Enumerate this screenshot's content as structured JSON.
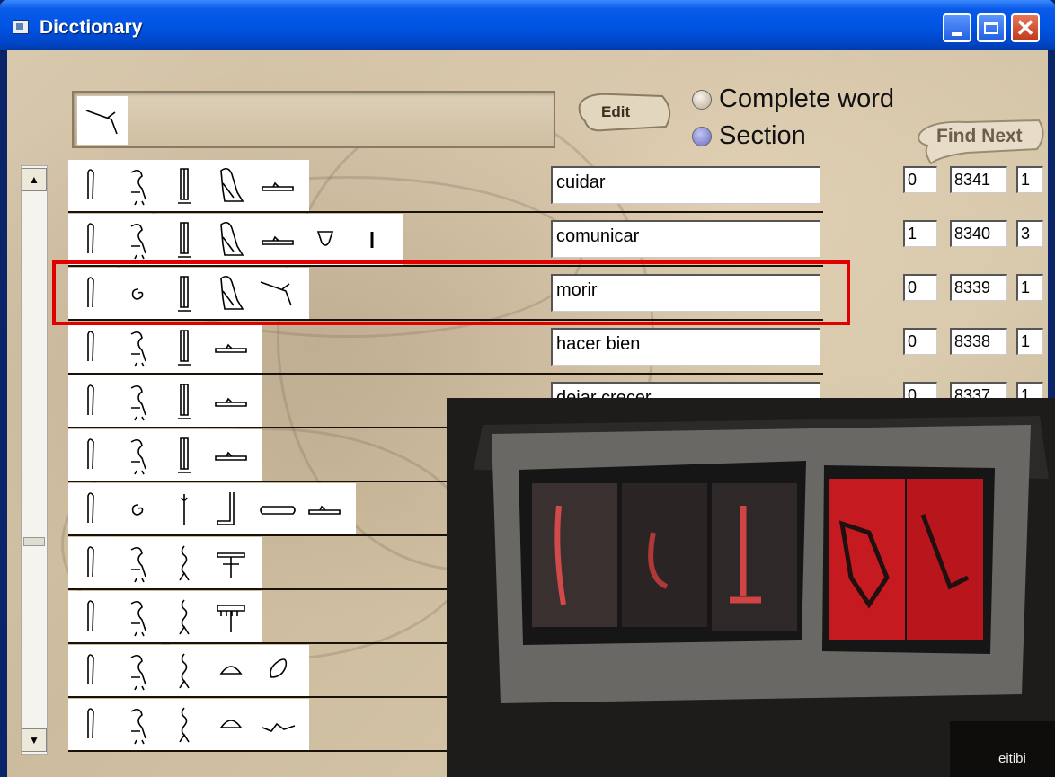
{
  "window": {
    "title": "Dicctionary"
  },
  "search": {
    "glyphs": [
      "stick"
    ]
  },
  "edit_label": "Edit",
  "radios": [
    {
      "label": "Complete word",
      "selected": false
    },
    {
      "label": "Section",
      "selected": true
    }
  ],
  "find_next_label": "Find Next",
  "rows": [
    {
      "glyphs": [
        "reed",
        "vulture",
        "column",
        "bird",
        "water"
      ],
      "word": "cuidar",
      "n1": "0",
      "n2": "8341",
      "n3": "1"
    },
    {
      "glyphs": [
        "reed",
        "vulture",
        "column",
        "bird",
        "water",
        "pot",
        "stroke"
      ],
      "word": "comunicar",
      "n1": "1",
      "n2": "8340",
      "n3": "3"
    },
    {
      "glyphs": [
        "reed",
        "spiral",
        "column",
        "bird",
        "stick"
      ],
      "word": "morir",
      "n1": "0",
      "n2": "8339",
      "n3": "1"
    },
    {
      "glyphs": [
        "reed",
        "vulture",
        "column",
        "water"
      ],
      "word": "hacer bien",
      "n1": "0",
      "n2": "8338",
      "n3": "1"
    },
    {
      "glyphs": [
        "reed",
        "vulture",
        "column",
        "water"
      ],
      "word": "dejar crecer",
      "n1": "0",
      "n2": "8337",
      "n3": "1"
    },
    {
      "glyphs": [
        "reed",
        "vulture",
        "column",
        "water"
      ]
    },
    {
      "glyphs": [
        "reed",
        "spiral",
        "plant",
        "boot",
        "bar",
        "water"
      ]
    },
    {
      "glyphs": [
        "reed",
        "vulture",
        "rope",
        "table"
      ]
    },
    {
      "glyphs": [
        "reed",
        "vulture",
        "rope",
        "comb"
      ]
    },
    {
      "glyphs": [
        "reed",
        "vulture",
        "rope",
        "dome",
        "oval"
      ]
    },
    {
      "glyphs": [
        "reed",
        "vulture",
        "rope",
        "dome",
        "wave"
      ]
    }
  ],
  "highlighted_row": 2,
  "photo_watermark": "eitibi",
  "colors": {
    "titlebar": "#0055e5",
    "highlight": "#e00000",
    "parchment": "#d3c3a6"
  }
}
